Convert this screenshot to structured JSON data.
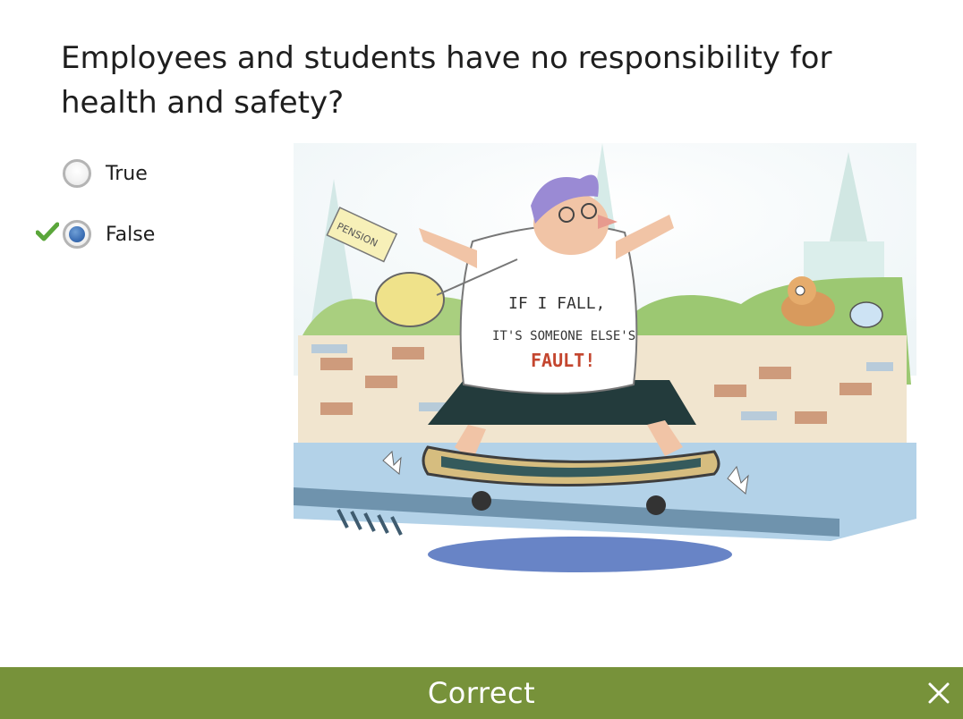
{
  "question": {
    "text": "Employees and students have no responsibility for health and safety?"
  },
  "options": [
    {
      "label": "True",
      "selected": false
    },
    {
      "label": "False",
      "selected": true
    }
  ],
  "illustration": {
    "shirt_line1": "IF I FALL,",
    "shirt_line2": "IT'S SOMEONE ELSE'S",
    "shirt_line3": "FAULT!",
    "paper_label": "PENSION"
  },
  "feedback": {
    "text": "Correct"
  },
  "colors": {
    "feedback_bar": "#77923a",
    "radio_selected": "#3c6fb5",
    "check": "#5aa63a"
  },
  "icons": {
    "correct_mark": "check-icon",
    "dismiss": "close-icon"
  }
}
